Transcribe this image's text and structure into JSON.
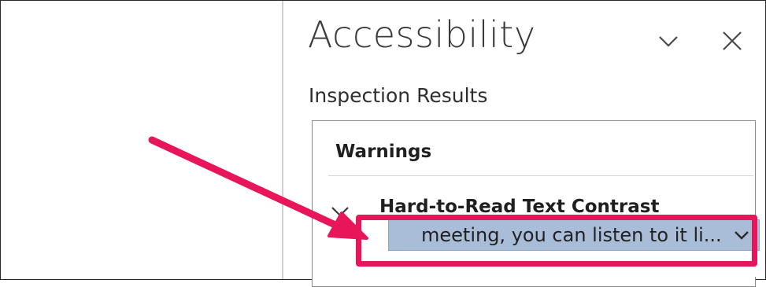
{
  "panel": {
    "title": "Accessibility",
    "collapse_icon": "chevron-down-icon",
    "close_icon": "close-icon"
  },
  "inspection": {
    "label": "Inspection Results",
    "warnings_heading": "Warnings",
    "group": {
      "label": "Hard-to-Read Text Contrast",
      "icon": "chevron-down-icon"
    },
    "selected_item": {
      "text": "meeting, you can listen to it li...",
      "icon": "chevron-down-icon"
    }
  },
  "annotation": {
    "color": "#e8155a",
    "selection_color": "#a9bcd8"
  }
}
